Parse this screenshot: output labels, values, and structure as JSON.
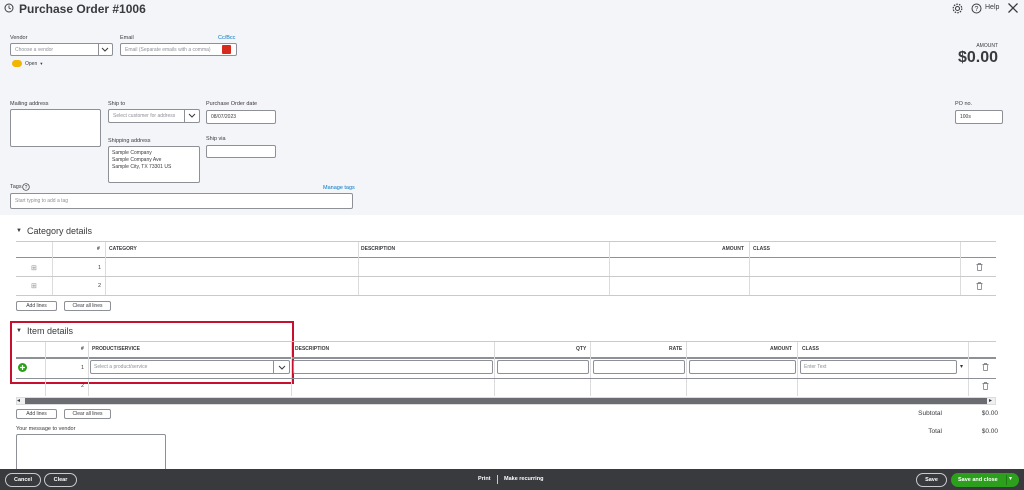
{
  "header": {
    "title": "Purchase Order #1006",
    "help_label": "Help"
  },
  "vendor": {
    "label": "Vendor",
    "placeholder": "Choose a vendor",
    "status": "Open"
  },
  "email": {
    "label": "Email",
    "placeholder": "Email (Separate emails with a comma)",
    "ccbcc_label": "Cc/Bcc"
  },
  "amount": {
    "label": "AMOUNT",
    "value": "$0.00"
  },
  "mailing": {
    "label": "Mailing address"
  },
  "ship_to": {
    "label": "Ship to",
    "placeholder": "Select customer for address"
  },
  "shipping_address": {
    "label": "Shipping address",
    "line1": "Sample Company",
    "line2": "Sample Company Ave",
    "line3": "Sample City, TX 73301 US"
  },
  "po_date": {
    "label": "Purchase Order date",
    "value": "08/07/2023"
  },
  "ship_via": {
    "label": "Ship via"
  },
  "po_no": {
    "label": "PO no.",
    "value": "100s"
  },
  "tags": {
    "label": "Tags",
    "manage_label": "Manage tags",
    "placeholder": "Start typing to add a tag"
  },
  "category_details": {
    "title": "Category details",
    "columns": {
      "num": "#",
      "category": "CATEGORY",
      "description": "DESCRIPTION",
      "amount": "AMOUNT",
      "class": "CLASS"
    },
    "rows": [
      {
        "num": "1"
      },
      {
        "num": "2"
      }
    ],
    "add_lines_label": "Add lines",
    "clear_lines_label": "Clear all lines"
  },
  "item_details": {
    "title": "Item details",
    "columns": {
      "num": "#",
      "product": "PRODUCT/SERVICE",
      "description": "DESCRIPTION",
      "qty": "QTY",
      "rate": "RATE",
      "amount": "AMOUNT",
      "class": "CLASS"
    },
    "rows": [
      {
        "num": "1"
      },
      {
        "num": "2"
      }
    ],
    "product_placeholder": "Select a product/service",
    "class_placeholder": "Enter Text",
    "add_lines_label": "Add lines",
    "clear_lines_label": "Clear all lines"
  },
  "totals": {
    "subtotal_label": "Subtotal",
    "subtotal_value": "$0.00",
    "total_label": "Total",
    "total_value": "$0.00"
  },
  "message": {
    "label": "Your message to vendor"
  },
  "footer": {
    "cancel_label": "Cancel",
    "clear_label": "Clear",
    "print_label": "Print",
    "recurring_label": "Make recurring",
    "save_label": "Save",
    "save_close_label": "Save and close"
  },
  "colors": {
    "accent_green": "#2ca01c",
    "link_blue": "#0077c5",
    "highlight_red": "#c8102e",
    "footer_bg": "#393a3d"
  }
}
